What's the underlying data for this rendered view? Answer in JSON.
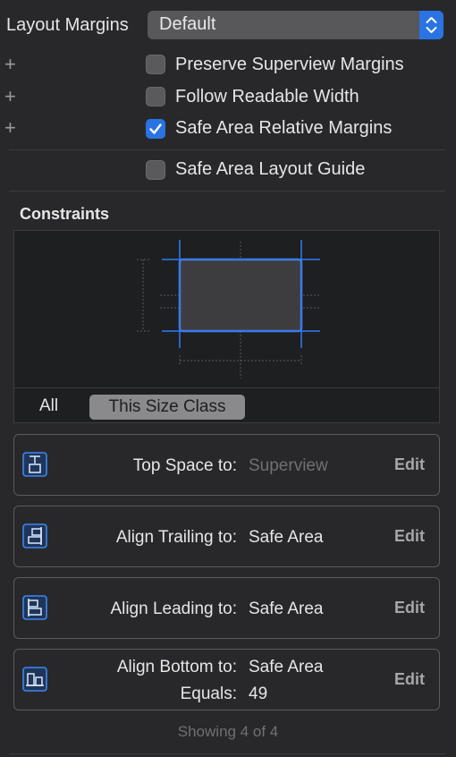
{
  "layout_margins": {
    "label": "Layout Margins",
    "selected": "Default"
  },
  "options": [
    {
      "label": "Preserve Superview Margins",
      "checked": false
    },
    {
      "label": "Follow Readable Width",
      "checked": false
    },
    {
      "label": "Safe Area Relative Margins",
      "checked": true
    }
  ],
  "safe_area_guide": {
    "label": "Safe Area Layout Guide",
    "checked": false
  },
  "constraints": {
    "title": "Constraints",
    "segments": {
      "all": "All",
      "size_class": "This Size Class"
    },
    "items": [
      {
        "icon": "top-space-icon",
        "key": "Top Space to:",
        "value": "Superview",
        "edit": "Edit"
      },
      {
        "icon": "align-trailing-icon",
        "key": "Align Trailing to:",
        "value": "Safe Area",
        "edit": "Edit"
      },
      {
        "icon": "align-leading-icon",
        "key": "Align Leading to:",
        "value": "Safe Area",
        "edit": "Edit"
      },
      {
        "icon": "align-bottom-icon",
        "key": "Align Bottom to:",
        "value": "Safe Area",
        "key2": "Equals:",
        "value2": "49",
        "edit": "Edit"
      }
    ],
    "footer": "Showing 4 of 4"
  },
  "colors": {
    "accent": "#2b73e2",
    "background": "#28282b"
  }
}
